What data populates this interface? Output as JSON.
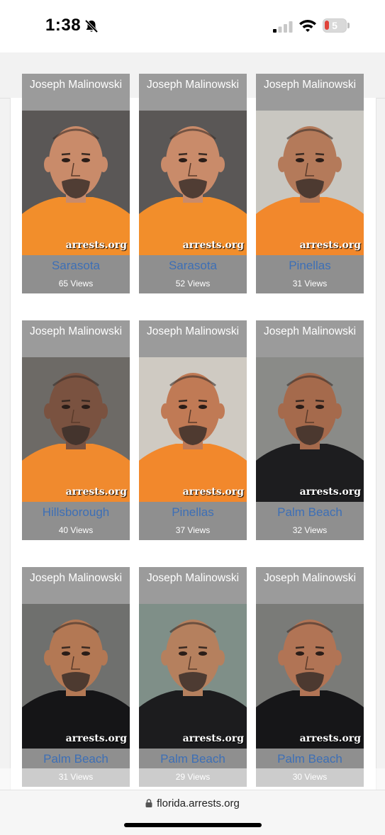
{
  "status_bar": {
    "time": "1:38",
    "battery_level": "5"
  },
  "browser": {
    "url": "florida.arrests.org"
  },
  "watermark": "arrests.org",
  "colors": {
    "county_link": "#3d6fb6",
    "card_bg": "#8f8f8f",
    "name_bar": "#9b9b9b"
  },
  "cards": [
    {
      "name": "Joseph Malinowski",
      "county": "Sarasota",
      "views": "65 Views",
      "bg": "#5a5756",
      "shirt": "#f28e2b",
      "skin": "#c98b6a"
    },
    {
      "name": "Joseph Malinowski",
      "county": "Sarasota",
      "views": "52 Views",
      "bg": "#5a5756",
      "shirt": "#f28e2b",
      "skin": "#c98b6a"
    },
    {
      "name": "Joseph Malinowski",
      "county": "Pinellas",
      "views": "31 Views",
      "bg": "#c9c7c1",
      "shirt": "#f2882c",
      "skin": "#b47a5a"
    },
    {
      "name": "Joseph Malinowski",
      "county": "Hillsborough",
      "views": "40 Views",
      "bg": "#6d6a66",
      "shirt": "#f08a2e",
      "skin": "#7a5240"
    },
    {
      "name": "Joseph Malinowski",
      "county": "Pinellas",
      "views": "37 Views",
      "bg": "#cfcac2",
      "shirt": "#f2882c",
      "skin": "#c07a55"
    },
    {
      "name": "Joseph Malinowski",
      "county": "Palm Beach",
      "views": "32 Views",
      "bg": "#8a8b88",
      "shirt": "#1d1d1f",
      "skin": "#a56a4c"
    },
    {
      "name": "Joseph Malinowski",
      "county": "Palm Beach",
      "views": "31 Views",
      "bg": "#6f706e",
      "shirt": "#151517",
      "skin": "#b37854"
    },
    {
      "name": "Joseph Malinowski",
      "county": "Palm Beach",
      "views": "29 Views",
      "bg": "#7f8f88",
      "shirt": "#1c1c1e",
      "skin": "#b5805e"
    },
    {
      "name": "Joseph Malinowski",
      "county": "Palm Beach",
      "views": "30 Views",
      "bg": "#7a7b78",
      "shirt": "#161618",
      "skin": "#b17455"
    }
  ]
}
